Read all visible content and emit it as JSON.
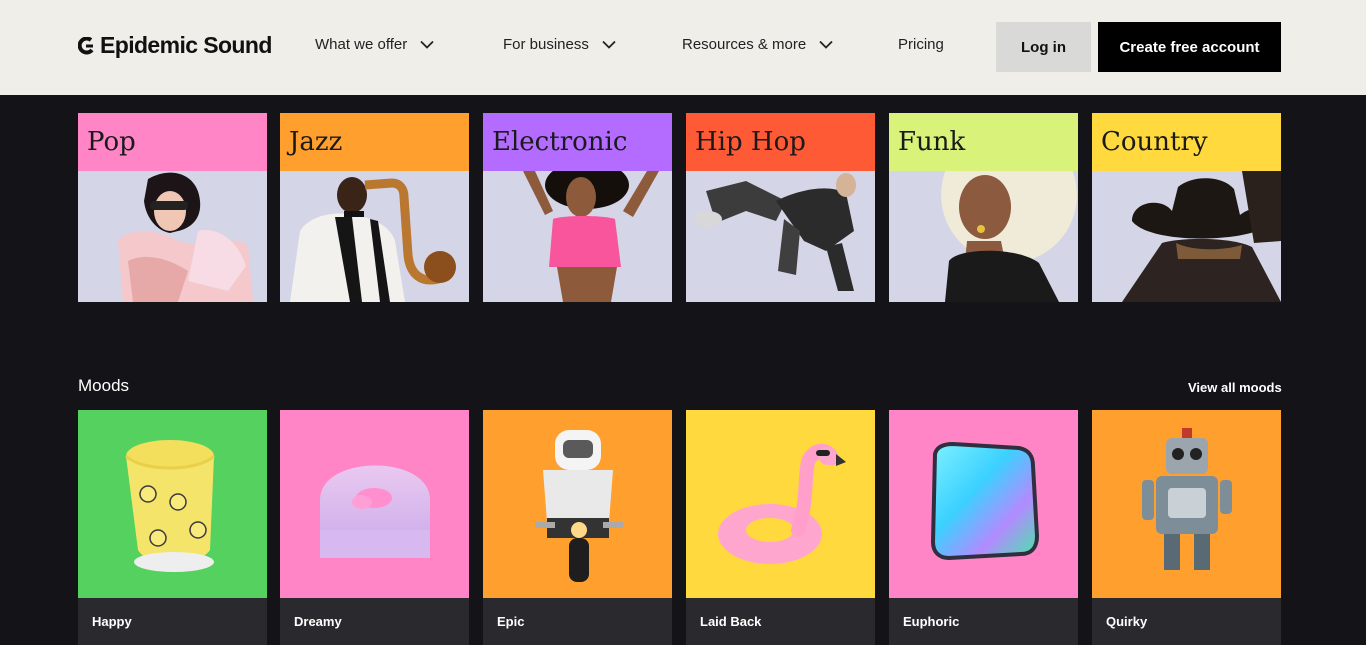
{
  "brand": {
    "name": "Epidemic Sound"
  },
  "nav": {
    "items": [
      {
        "label": "What we offer",
        "has_dropdown": true
      },
      {
        "label": "For business",
        "has_dropdown": true
      },
      {
        "label": "Resources & more",
        "has_dropdown": true
      },
      {
        "label": "Pricing",
        "has_dropdown": false
      }
    ],
    "login_label": "Log in",
    "create_label": "Create free account"
  },
  "genres": [
    {
      "label": "Pop",
      "color": "#ff85c6",
      "icon": "pop-artist-image"
    },
    {
      "label": "Jazz",
      "color": "#ff9f2e",
      "icon": "saxophone-player-image"
    },
    {
      "label": "Electronic",
      "color": "#b36cff",
      "icon": "dancer-image"
    },
    {
      "label": "Hip Hop",
      "color": "#ff5a36",
      "icon": "breakdancer-image"
    },
    {
      "label": "Funk",
      "color": "#d8f27a",
      "icon": "afro-singer-image"
    },
    {
      "label": "Country",
      "color": "#ffd93d",
      "icon": "cowboy-image"
    }
  ],
  "moods": {
    "title": "Moods",
    "view_all_label": "View all moods",
    "items": [
      {
        "label": "Happy",
        "color": "#55d160",
        "icon": "smiley-tape-image"
      },
      {
        "label": "Dreamy",
        "color": "#ff85c6",
        "icon": "cloud-arch-image"
      },
      {
        "label": "Epic",
        "color": "#ff9f2e",
        "icon": "astronaut-motorbike-image"
      },
      {
        "label": "Laid Back",
        "color": "#ffd93d",
        "icon": "flamingo-float-image"
      },
      {
        "label": "Euphoric",
        "color": "#ff85c6",
        "icon": "holographic-cube-image"
      },
      {
        "label": "Quirky",
        "color": "#ff9f2e",
        "icon": "toy-robot-image"
      }
    ]
  }
}
